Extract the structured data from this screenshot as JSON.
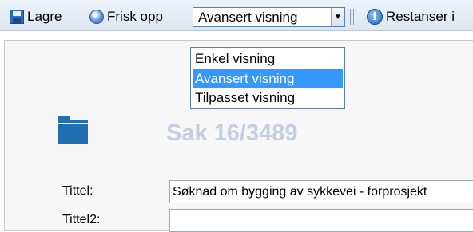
{
  "toolbar": {
    "save_label": "Lagre",
    "refresh_label": "Frisk opp",
    "view_selected": "Avansert visning",
    "restances_label": "Restanser i"
  },
  "dropdown": {
    "options": [
      "Enkel visning",
      "Avansert visning",
      "Tilpasset visning"
    ],
    "selected_index": 1
  },
  "case": {
    "title": "Sak 16/3489"
  },
  "form": {
    "title_label": "Tittel:",
    "title_value": "Søknad om bygging av sykkevei - forprosjekt",
    "title2_label": "Tittel2:",
    "title2_value": ""
  },
  "colors": {
    "accent": "#3399ff",
    "folder": "#1f6fb2",
    "case_title": "#c3cfe0"
  }
}
